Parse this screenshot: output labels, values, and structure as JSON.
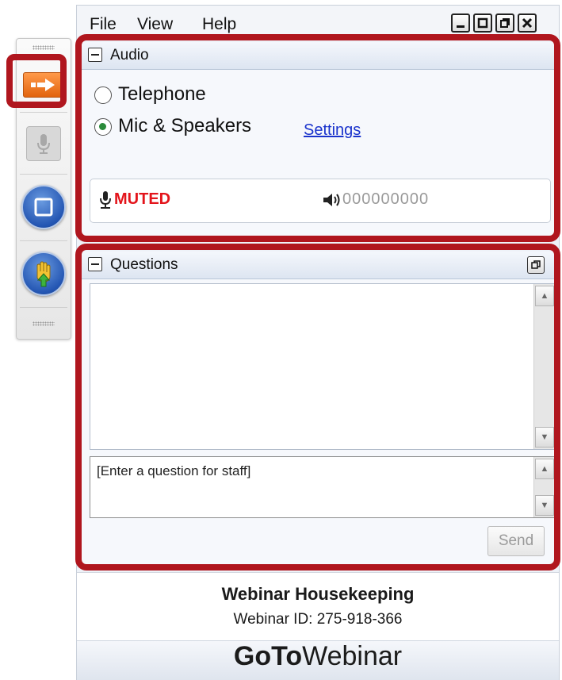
{
  "menu": {
    "file": "File",
    "view": "View",
    "help": "Help"
  },
  "window_controls": [
    "minimize",
    "maximize",
    "restore",
    "close"
  ],
  "toolbar": {
    "items": [
      {
        "name": "show-hide-control-panel",
        "icon": "arrow-right-icon",
        "highlighted": true
      },
      {
        "name": "microphone",
        "icon": "microphone-icon",
        "enabled": false
      },
      {
        "name": "screen",
        "icon": "screen-icon"
      },
      {
        "name": "raise-hand",
        "icon": "hand-icon"
      }
    ]
  },
  "audio": {
    "title": "Audio",
    "options": [
      {
        "label": "Telephone",
        "selected": false
      },
      {
        "label": "Mic & Speakers",
        "selected": true
      }
    ],
    "settings_link": "Settings",
    "mute_status": "MUTED",
    "level_meter": "000000000"
  },
  "questions": {
    "title": "Questions",
    "placeholder": "[Enter a question for staff]",
    "send_label": "Send"
  },
  "footer": {
    "title": "Webinar Housekeeping",
    "webinar_id": "Webinar ID: 275-918-366",
    "brand_bold": "GoTo",
    "brand_light": "Webinar"
  },
  "colors": {
    "highlight": "#b0161e",
    "muted_text": "#e3141b",
    "link": "#1a33cc",
    "arrow_button": "#f07a23",
    "circle_button": "#2456b3"
  }
}
